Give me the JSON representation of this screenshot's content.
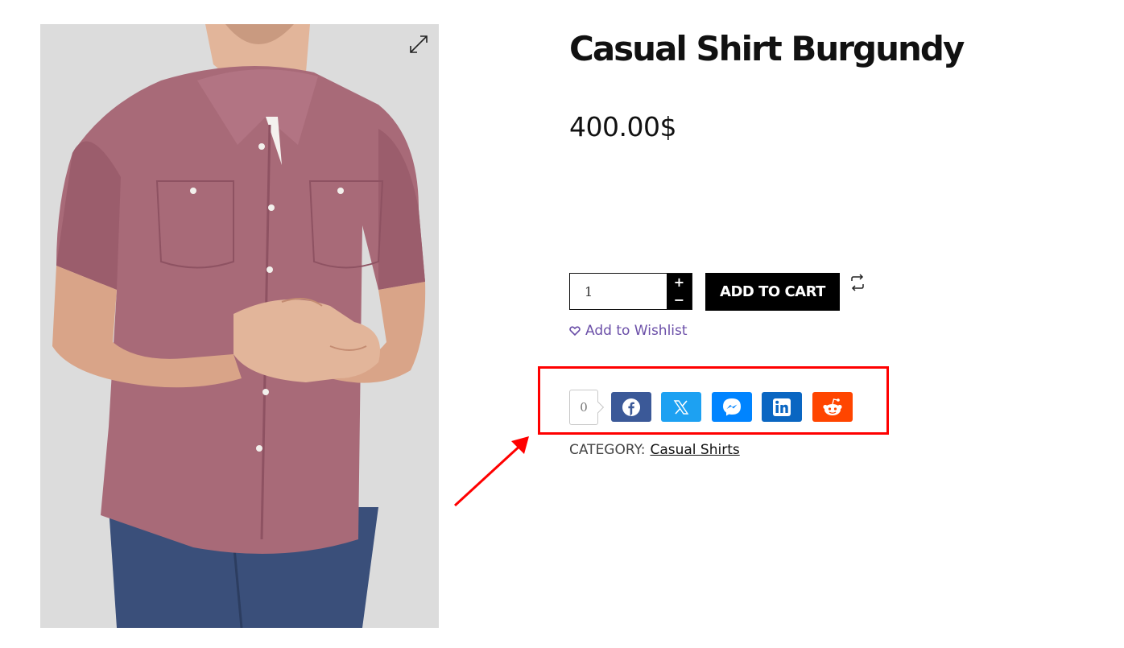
{
  "product": {
    "title": "Casual Shirt Burgundy",
    "price": "400.00$",
    "quantity": "1",
    "add_to_cart_label": "ADD TO CART",
    "wishlist_label": "Add to Wishlist",
    "category_label": "CATEGORY:",
    "category_value": "Casual Shirts"
  },
  "qty_stepper": {
    "plus": "+",
    "minus": "−"
  },
  "share": {
    "count": "0",
    "buttons": [
      {
        "network": "facebook",
        "icon": "facebook-icon",
        "color": "#3b5998"
      },
      {
        "network": "x",
        "icon": "x-icon",
        "color": "#1da1f2"
      },
      {
        "network": "messenger",
        "icon": "messenger-icon",
        "color": "#0084ff"
      },
      {
        "network": "linkedin",
        "icon": "linkedin-icon",
        "color": "#0a66c2"
      },
      {
        "network": "reddit",
        "icon": "reddit-icon",
        "color": "#ff4500"
      }
    ]
  },
  "colors": {
    "annotation": "#ff0000",
    "wishlist": "#6b4fa8",
    "image_background": "#dcdcdc"
  }
}
